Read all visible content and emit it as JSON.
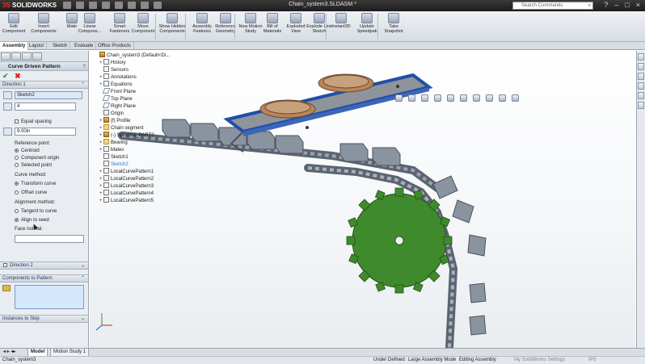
{
  "app": {
    "logo": "SOLIDWORKS",
    "logo_prefix": "3S",
    "document_title": "Chain_system3.SLDASM *",
    "search_placeholder": "Search Commands"
  },
  "command_manager": [
    {
      "label": "Edit Component",
      "icon": "edit-component-icon"
    },
    {
      "label": "Insert Components",
      "icon": "insert-components-icon"
    },
    {
      "label": "Mate",
      "icon": "mate-icon"
    },
    {
      "label": "Linear Compone...",
      "icon": "linear-pattern-icon"
    },
    {
      "label": "Smart Fasteners",
      "icon": "smart-fasteners-icon"
    },
    {
      "label": "Move Component",
      "icon": "move-component-icon"
    },
    {
      "label": "Show Hidden Components",
      "icon": "show-hidden-icon"
    },
    {
      "label": "Assembly Features",
      "icon": "assembly-features-icon"
    },
    {
      "label": "Reference Geometry",
      "icon": "reference-geometry-icon"
    },
    {
      "label": "New Motion Study",
      "icon": "motion-study-icon"
    },
    {
      "label": "Bill of Materials",
      "icon": "bom-icon"
    },
    {
      "label": "Exploded View",
      "icon": "exploded-view-icon"
    },
    {
      "label": "Explode Line Sketch",
      "icon": "explode-line-icon"
    },
    {
      "label": "Instant3D",
      "icon": "instant3d-icon"
    },
    {
      "label": "Update Speedpak",
      "icon": "speedpak-icon"
    },
    {
      "label": "Take Snapshot",
      "icon": "snapshot-icon"
    }
  ],
  "tabs": [
    "Assembly",
    "Layout",
    "Sketch",
    "Evaluate",
    "Office Products"
  ],
  "active_tab": "Assembly",
  "property_manager": {
    "title": "Curve Driven Pattern",
    "direction1": {
      "header": "Direction 1",
      "curve": "Sketch2",
      "instances": "4",
      "equal_spacing": "Equal spacing",
      "spacing": "9.00in",
      "reference_point_label": "Reference point:",
      "reference_options": [
        "Centroid",
        "Component origin",
        "Selected point"
      ],
      "reference_selected": "Centroid",
      "curve_method_label": "Curve method:",
      "curve_method_options": [
        "Transform curve",
        "Offset curve"
      ],
      "alignment_label": "Alignment method:",
      "alignment_options": [
        "Tangent to curve",
        "Align to seed"
      ],
      "face_normal_label": "Face normal:"
    },
    "direction2": {
      "header": "Direction 2"
    },
    "components": {
      "header": "Components to Pattern"
    },
    "instances_skip": {
      "header": "Instances to Skip"
    }
  },
  "feature_tree": [
    {
      "label": "Chain_system3 (Default<Di...",
      "icon": "assembly-icon",
      "expand": "",
      "indent": 0
    },
    {
      "label": "History",
      "icon": "history-icon",
      "expand": "+",
      "indent": 1
    },
    {
      "label": "Sensors",
      "icon": "sensors-icon",
      "expand": "",
      "indent": 1
    },
    {
      "label": "Annotations",
      "icon": "annotations-icon",
      "expand": "+",
      "indent": 1
    },
    {
      "label": "Equations",
      "icon": "equations-icon",
      "expand": "+",
      "indent": 1
    },
    {
      "label": "Front Plane",
      "icon": "plane-icon",
      "expand": "",
      "indent": 1
    },
    {
      "label": "Top Plane",
      "icon": "plane-icon",
      "expand": "",
      "indent": 1
    },
    {
      "label": "Right Plane",
      "icon": "plane-icon",
      "expand": "",
      "indent": 1
    },
    {
      "label": "Origin",
      "icon": "origin-icon",
      "expand": "",
      "indent": 1
    },
    {
      "label": "(f) Profile",
      "icon": "part-icon",
      "expand": "+",
      "indent": 1
    },
    {
      "label": "Chain segment",
      "icon": "folder-icon",
      "expand": "+",
      "indent": 1
    },
    {
      "label": "(-) Sprocket_PARTS",
      "icon": "part-icon",
      "expand": "+",
      "indent": 1
    },
    {
      "label": "Bearing",
      "icon": "folder-icon",
      "expand": "+",
      "indent": 1
    },
    {
      "label": "Mates",
      "icon": "mates-icon",
      "expand": "+",
      "indent": 1
    },
    {
      "label": "Sketch1",
      "icon": "sketch-icon",
      "expand": "",
      "indent": 1
    },
    {
      "label": "Sketch2",
      "icon": "sketch-icon",
      "expand": "",
      "indent": 1,
      "highlight": true
    },
    {
      "label": "LocalCurvePattern1",
      "icon": "pattern-icon",
      "expand": "+",
      "indent": 1
    },
    {
      "label": "LocalCurvePattern2",
      "icon": "pattern-icon",
      "expand": "+",
      "indent": 1
    },
    {
      "label": "LocalCurvePattern3",
      "icon": "pattern-icon",
      "expand": "+",
      "indent": 1
    },
    {
      "label": "LocalCurvePattern4",
      "icon": "pattern-icon",
      "expand": "+",
      "indent": 1
    },
    {
      "label": "LocalCurvePattern5",
      "icon": "pattern-icon",
      "expand": "+",
      "indent": 1
    }
  ],
  "bottom_tabs": [
    "Model",
    "Motion Study 1"
  ],
  "status": {
    "left": "Chain_system3",
    "state": "Under Defined",
    "mode": "Large Assembly Mode",
    "editing": "Editing Assembly",
    "settings": "My SolidWorks Settings",
    "units": "IPS"
  },
  "colors": {
    "sprocket": "#3f8a2c",
    "chain": "#6f7886",
    "plate_border": "#1f4fa8",
    "bearing": "#b98559",
    "accent": "#2955a8"
  }
}
